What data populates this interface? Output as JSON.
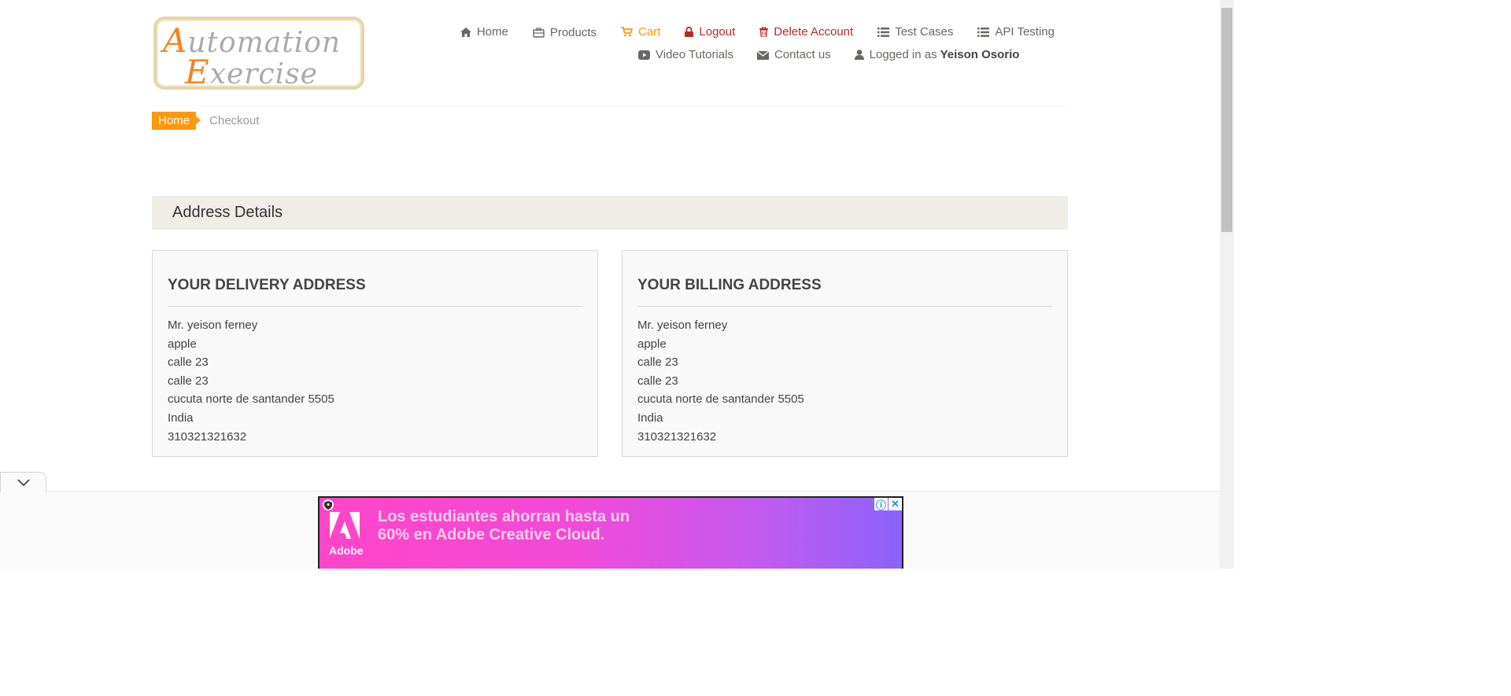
{
  "logo": {
    "line1": "utomation",
    "line1_cap": "A",
    "line2": "xercise",
    "line2_cap": "E"
  },
  "nav": {
    "home": "Home",
    "products": "Products",
    "cart": "Cart",
    "logout": "Logout",
    "delete_account": "Delete Account",
    "test_cases": "Test Cases",
    "api_testing": "API Testing",
    "video_tutorials": "Video Tutorials",
    "contact_us": "Contact us",
    "logged_in_prefix": "Logged in as",
    "logged_in_user": "Yeison Osorio"
  },
  "breadcrumb": {
    "home": "Home",
    "current": "Checkout"
  },
  "address_section": {
    "heading": "Address Details",
    "delivery": {
      "title": "YOUR DELIVERY ADDRESS",
      "lines": [
        "Mr. yeison ferney",
        "apple",
        "calle 23",
        "calle 23",
        "cucuta norte de santander 5505",
        "India",
        "310321321632"
      ]
    },
    "billing": {
      "title": "YOUR BILLING ADDRESS",
      "lines": [
        "Mr. yeison ferney",
        "apple",
        "calle 23",
        "calle 23",
        "cucuta norte de santander 5505",
        "India",
        "310321321632"
      ]
    }
  },
  "ad": {
    "brand": "Adobe",
    "line1": "Los estudiantes ahorran hasta un",
    "line2": "60% en Adobe Creative Cloud.",
    "info_icon": "info-icon",
    "close_icon": "close-icon"
  },
  "colors": {
    "accent": "#fe980f",
    "danger": "#b52a2a",
    "heading_bg": "#efede6"
  }
}
